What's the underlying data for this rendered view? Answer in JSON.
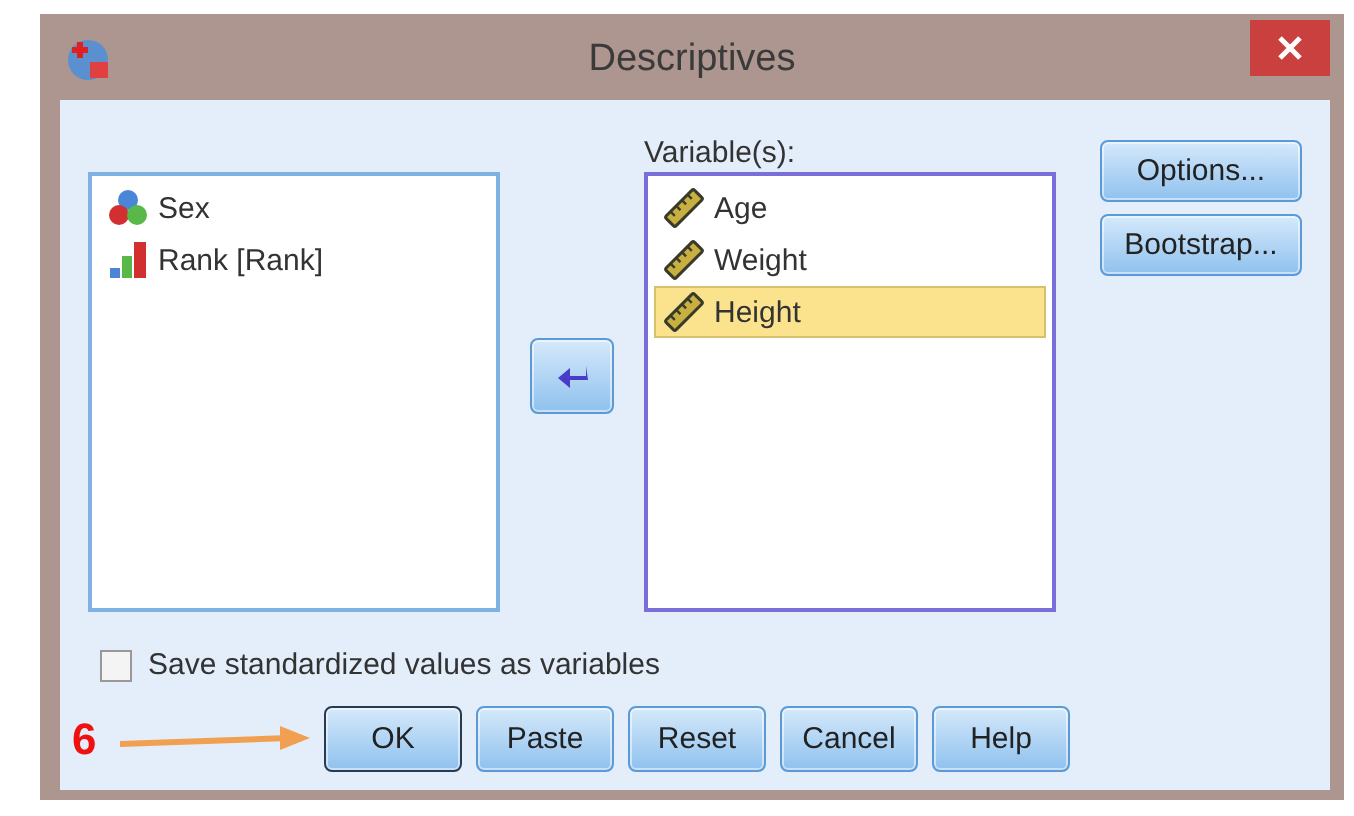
{
  "window": {
    "title": "Descriptives"
  },
  "source_list": {
    "items": [
      {
        "label": "Sex",
        "kind": "nominal",
        "selected": false
      },
      {
        "label": "Rank [Rank]",
        "kind": "ordinal",
        "selected": false
      }
    ]
  },
  "variables": {
    "label": "Variable(s):",
    "items": [
      {
        "label": "Age",
        "kind": "scale",
        "selected": false
      },
      {
        "label": "Weight",
        "kind": "scale",
        "selected": false
      },
      {
        "label": "Height",
        "kind": "scale",
        "selected": true
      }
    ]
  },
  "side_buttons": [
    "Options...",
    "Bootstrap..."
  ],
  "save_standardized": {
    "label": "Save standardized values as variables",
    "checked": false
  },
  "annotation": {
    "label": "6"
  },
  "buttons": [
    {
      "label": "OK",
      "default": true
    },
    {
      "label": "Paste",
      "default": false
    },
    {
      "label": "Reset",
      "default": false
    },
    {
      "label": "Cancel",
      "default": false
    },
    {
      "label": "Help",
      "default": false
    }
  ]
}
